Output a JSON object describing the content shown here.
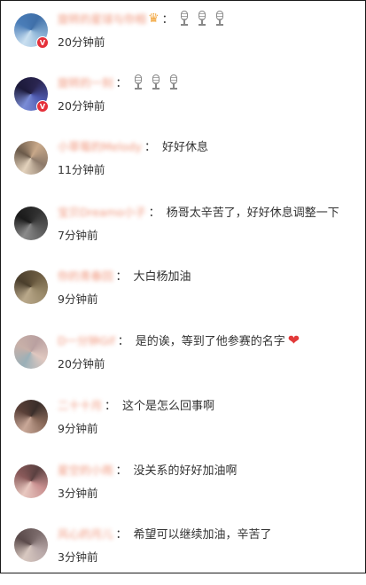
{
  "comments": [
    {
      "name": "旋转的星球与你相",
      "text": "",
      "badge": "crown-icon",
      "mics": 3,
      "time": "20分钟前",
      "verified": true,
      "avatar_colors": [
        "#3f6fa8",
        "#8fb6d8",
        "#c9dff0",
        "#4a7db8"
      ]
    },
    {
      "name": "旋转的一刻",
      "text": "",
      "mics": 3,
      "time": "20分钟前",
      "verified": true,
      "avatar_colors": [
        "#2a2550",
        "#4e5ab0",
        "#7a8cd6",
        "#1c1a3a"
      ]
    },
    {
      "name": "小草莓的Melody",
      "text": "好好休息",
      "time": "11分钟前",
      "avatar_colors": [
        "#c9a98a",
        "#8d7a6a",
        "#e3d2bc",
        "#6b5a4a"
      ]
    },
    {
      "name": "宝贝Dreamo小子",
      "text": "杨哥太辛苦了，好好休息调整一下",
      "time": "7分钟前",
      "avatar_colors": [
        "#303030",
        "#5a5a5a",
        "#8a8a8a",
        "#1a1a1a"
      ]
    },
    {
      "name": "你的青春回",
      "text": "大白杨加油",
      "time": "9分钟前",
      "avatar_colors": [
        "#6a5a40",
        "#9a8a6a",
        "#b9a88a",
        "#4a3e2c"
      ]
    },
    {
      "name": "D一分钟Gif",
      "text": "是的诶，等到了他参赛的名字",
      "heart": true,
      "time": "20分钟前",
      "avatar_colors": [
        "#b9a0a0",
        "#e0c8c0",
        "#9ab0b8",
        "#c8b0a8"
      ]
    },
    {
      "name": "二十十月",
      "text": "这个是怎么回事啊",
      "time": "9分钟前",
      "avatar_colors": [
        "#3a2e2a",
        "#8a6a5a",
        "#c9a898",
        "#5a4038"
      ]
    },
    {
      "name": "星空的小雨",
      "text": "没关系的好好加油啊",
      "time": "3分钟前",
      "avatar_colors": [
        "#5a4040",
        "#c99090",
        "#e8c8c0",
        "#8a5a5a"
      ]
    },
    {
      "name": "风心的月儿",
      "text": "希望可以继续加油，辛苦了",
      "time": "3分钟前",
      "avatar_colors": [
        "#7a6a6a",
        "#b8a8a8",
        "#d8c8c0",
        "#5a4a4a"
      ]
    }
  ]
}
